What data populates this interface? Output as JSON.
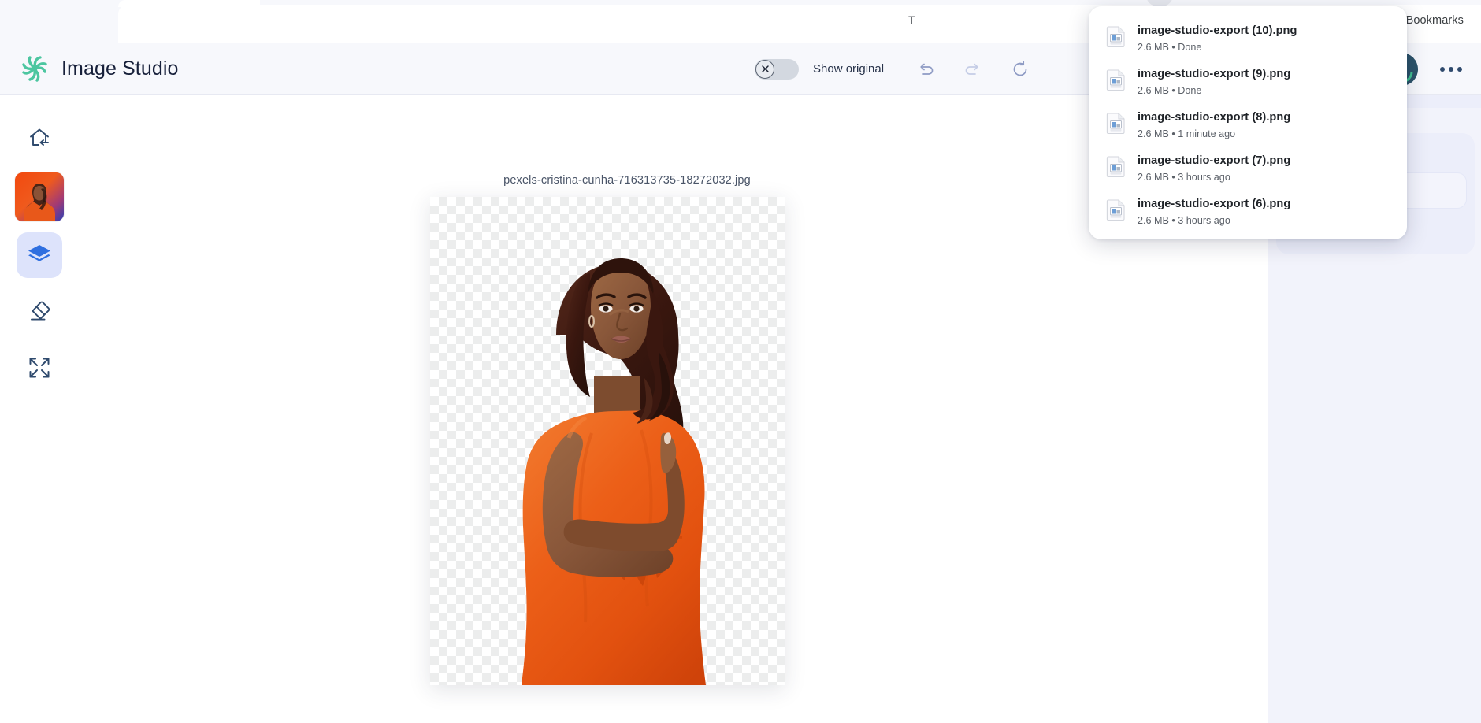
{
  "browser": {
    "bookmarks_label": "Bookmarks",
    "omnibox_hint": "T"
  },
  "app": {
    "title": "Image Studio",
    "logo_icon": "pinwheel-logo-icon",
    "accent_color": "#4cc6a0",
    "title_color": "#17203a"
  },
  "header": {
    "show_original_label": "Show original",
    "show_original_state": "off",
    "toggle_icon": "close-circle-icon",
    "undo_icon": "undo-icon",
    "redo_icon": "redo-icon",
    "reset_icon": "reset-icon",
    "avatar_icon": "user-avatar",
    "more_icon": "more-horizontal-icon"
  },
  "sidebar": {
    "items": [
      {
        "name": "home-exit",
        "icon": "home-arrow-left-icon",
        "active": false
      },
      {
        "name": "image-thumbnail",
        "icon": "image-thumbnail",
        "active": false
      },
      {
        "name": "layers",
        "icon": "layers-icon",
        "active": true
      },
      {
        "name": "eraser",
        "icon": "eraser-icon",
        "active": false
      },
      {
        "name": "expand",
        "icon": "expand-arrows-icon",
        "active": false
      }
    ]
  },
  "canvas": {
    "filename": "pexels-cristina-cunha-716313735-18272032.jpg",
    "background": "transparent-checkerboard"
  },
  "right_panel": {
    "chevron_icon": "chevron-down-icon"
  },
  "downloads": {
    "items": [
      {
        "name": "image-studio-export (10).png",
        "meta": "2.6 MB • Done",
        "icon": "png-file-icon"
      },
      {
        "name": "image-studio-export (9).png",
        "meta": "2.6 MB • Done",
        "icon": "png-file-icon"
      },
      {
        "name": "image-studio-export (8).png",
        "meta": "2.6 MB • 1 minute ago",
        "icon": "png-file-icon"
      },
      {
        "name": "image-studio-export (7).png",
        "meta": "2.6 MB • 3 hours ago",
        "icon": "png-file-icon"
      },
      {
        "name": "image-studio-export (6).png",
        "meta": "2.6 MB • 3 hours ago",
        "icon": "png-file-icon"
      }
    ]
  }
}
